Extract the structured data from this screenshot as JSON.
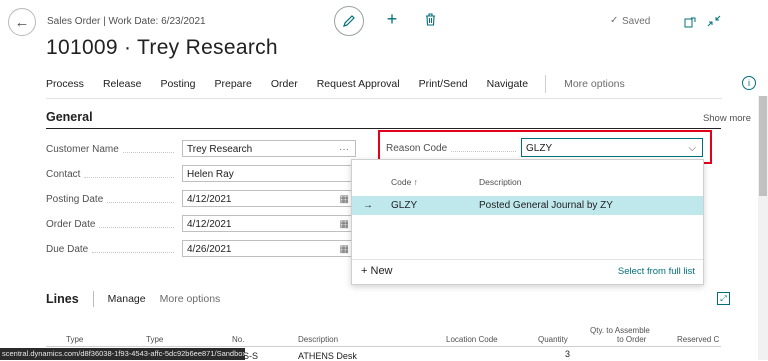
{
  "header": {
    "breadcrumb": "Sales Order | Work Date: 6/23/2021",
    "title": "101009 · Trey Research",
    "saved": "Saved"
  },
  "actions": [
    "Process",
    "Release",
    "Posting",
    "Prepare",
    "Order",
    "Request Approval",
    "Print/Send",
    "Navigate"
  ],
  "more_options": "More options",
  "general": {
    "title": "General",
    "show_more": "Show more",
    "fields": [
      {
        "label": "Customer Name",
        "value": "Trey Research",
        "aux": "···"
      },
      {
        "label": "Contact",
        "value": "Helen Ray",
        "aux": ""
      },
      {
        "label": "Posting Date",
        "value": "4/12/2021",
        "aux": "📅"
      },
      {
        "label": "Order Date",
        "value": "4/12/2021",
        "aux": "📅"
      },
      {
        "label": "Due Date",
        "value": "4/26/2021",
        "aux": "📅"
      }
    ],
    "reason_code": {
      "label": "Reason Code",
      "value": "GLZY"
    }
  },
  "dropdown": {
    "col_code": "Code ↑",
    "col_description": "Description",
    "rows": [
      {
        "code": "GLZY",
        "description": "Posted General Journal by ZY"
      }
    ],
    "new": "New",
    "select_full_list": "Select from full list"
  },
  "lines": {
    "title": "Lines",
    "manage": "Manage",
    "more_options": "More options",
    "columns": [
      "Type",
      "Type",
      "No.",
      "Description",
      "Location Code",
      "Quantity",
      "Qty. to Assemble",
      "to Order",
      "Reserved C"
    ],
    "first_row": {
      "no_partial": "S-S",
      "description": "ATHENS Desk",
      "quantity": "3"
    }
  },
  "status_url": "scentral.dynamics.com/d8f36038-1f93-4543-affc-5dc92b6ee871/Sandbox..."
}
